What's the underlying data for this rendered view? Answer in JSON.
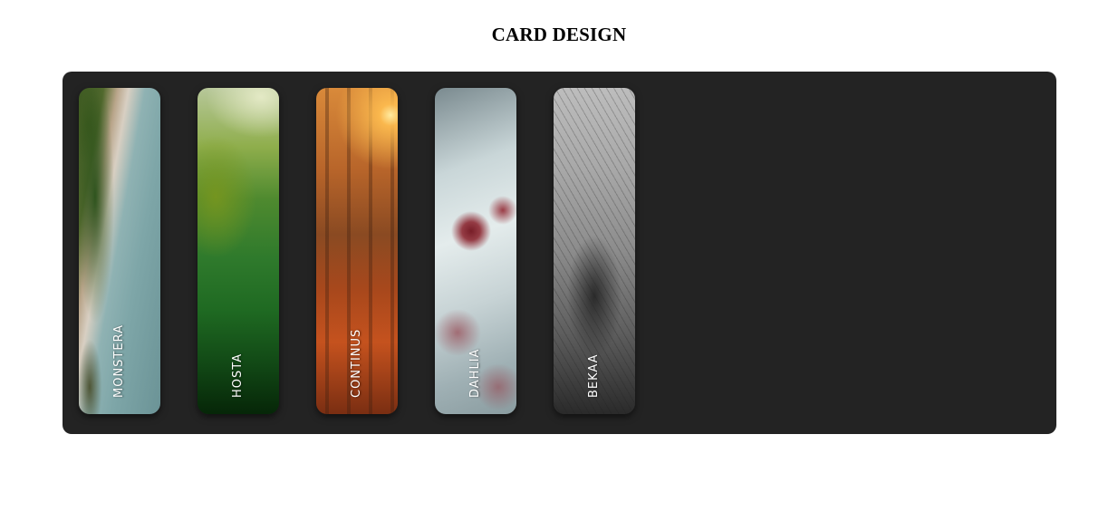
{
  "page": {
    "title": "CARD DESIGN"
  },
  "cards": [
    {
      "label": "MONSTERA"
    },
    {
      "label": "HOSTA"
    },
    {
      "label": "CONTINUS"
    },
    {
      "label": "DAHLIA"
    },
    {
      "label": "BEKAA"
    }
  ],
  "colors": {
    "panel_background": "#232323",
    "page_background": "#ffffff",
    "label_text": "#ffffff"
  }
}
